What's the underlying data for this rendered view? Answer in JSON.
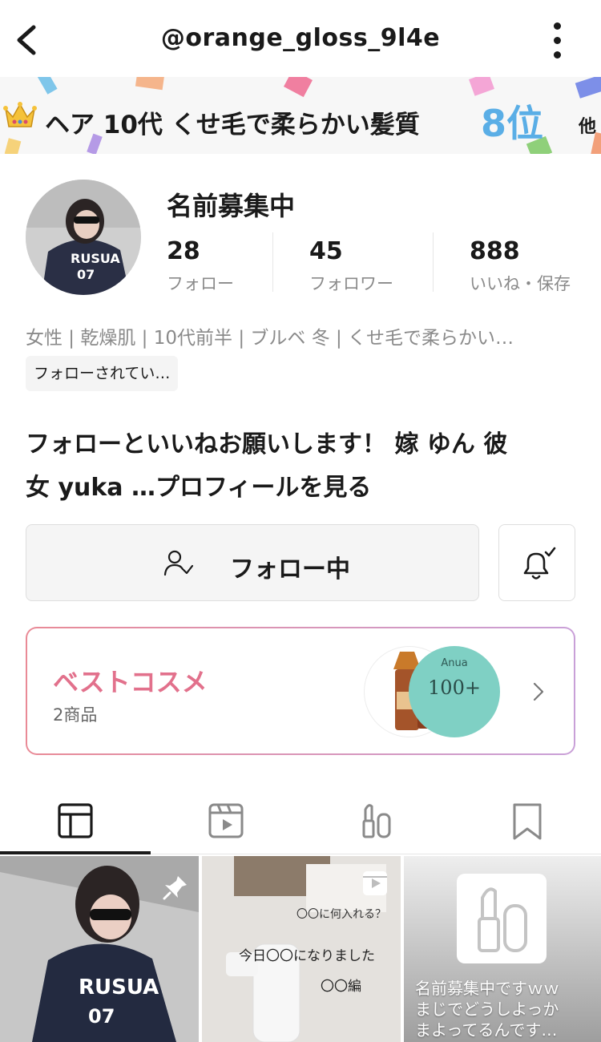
{
  "header": {
    "title": "@orange_gloss_9l4e"
  },
  "ranking": {
    "text": "ヘア 10代 くせ毛で柔らかい髪質",
    "position": "8位",
    "more": "他"
  },
  "profile": {
    "name": "名前募集中",
    "stats": [
      {
        "value": "28",
        "label": "フォロー"
      },
      {
        "value": "45",
        "label": "フォロワー"
      },
      {
        "value": "888",
        "label": "いいね・保存"
      }
    ],
    "tags": "女性 | 乾燥肌 | 10代前半 | ブルベ 冬 | くせ毛で柔らかい…",
    "follow_badge": "フォローされてい…",
    "bio_line1": "フォローといいねお願いします！ 嫁 ゆん 彼",
    "bio_line2": "女 yuka …プロフィールを見る"
  },
  "actions": {
    "following_label": "フォロー中"
  },
  "best_cosme": {
    "title": "ベストコスメ",
    "count": "2商品",
    "product2_brand": "Anua",
    "product2_text": "100+"
  },
  "tabs": [
    "posts",
    "videos",
    "cosmetics",
    "saved"
  ],
  "grid": {
    "cell2_caption1": "〇〇に何入れる？",
    "cell2_caption2": "今日〇〇になりました",
    "cell2_caption3": "〇〇編",
    "cell3_line1": "名前募集中ですｗｗ",
    "cell3_line2": "まじでどうしよっか",
    "cell3_line3": "まよってるんです…"
  },
  "colors": {
    "rank_accent": "#5aaee6",
    "cosme_title": "#e2718c",
    "text_primary": "#1a1a1a",
    "text_secondary": "#8a8a8a"
  },
  "icons": [
    "back-arrow-icon",
    "more-vertical-icon",
    "crown-icon",
    "user-check-icon",
    "bell-check-icon",
    "chevron-right-icon",
    "grid-icon",
    "video-icon",
    "lipstick-icon",
    "bookmark-icon",
    "pin-icon"
  ]
}
